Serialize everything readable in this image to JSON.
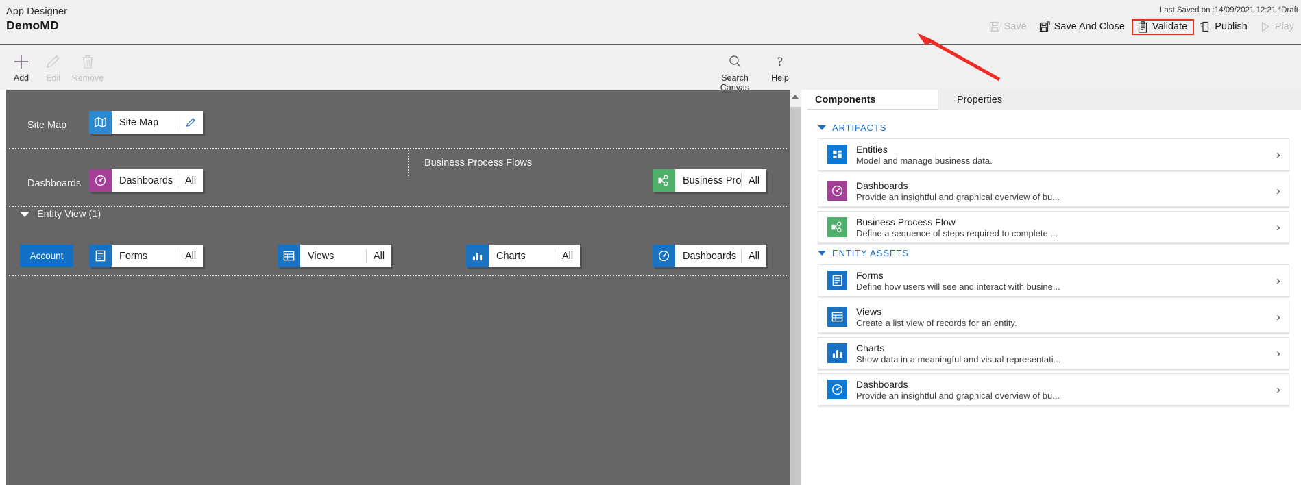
{
  "header": {
    "kicker": "App Designer",
    "title": "DemoMD",
    "last_saved": "Last Saved on :14/09/2021 12:21 *Draft",
    "commands": [
      {
        "label": "Save",
        "icon": "save-icon",
        "state": "disabled",
        "highlighted": false
      },
      {
        "label": "Save And Close",
        "icon": "save-close-icon",
        "state": "enabled",
        "highlighted": false
      },
      {
        "label": "Validate",
        "icon": "validate-icon",
        "state": "enabled",
        "highlighted": true
      },
      {
        "label": "Publish",
        "icon": "publish-icon",
        "state": "enabled",
        "highlighted": false
      },
      {
        "label": "Play",
        "icon": "play-icon",
        "state": "disabled",
        "highlighted": false
      }
    ],
    "highlight_color": "#ee2b24"
  },
  "ribbon": {
    "items": [
      {
        "label": "Add",
        "icon": "plus-icon",
        "state": "enabled"
      },
      {
        "label": "Edit",
        "icon": "pencil-icon",
        "state": "disabled"
      },
      {
        "label": "Remove",
        "icon": "trash-icon",
        "state": "disabled"
      }
    ],
    "right_items": [
      {
        "label": "Search Canvas",
        "icon": "search-icon",
        "state": "enabled"
      },
      {
        "label": "Help",
        "icon": "help-icon",
        "state": "enabled"
      }
    ]
  },
  "canvas": {
    "background": "#666666",
    "rows": [
      {
        "label": "Site Map",
        "tiles": [
          {
            "name": "Site Map",
            "icon": "sitemap-icon",
            "icon_color": "#2a8ad4",
            "trailing": "edit",
            "trailing_label": ""
          }
        ]
      },
      {
        "label": "Dashboards",
        "group_label": "Business Process Flows",
        "tiles": [
          {
            "name": "Dashboards",
            "icon": "dashboard-icon",
            "icon_color": "#a33f96",
            "trailing": "all",
            "trailing_label": "All"
          },
          {
            "name": "Business Proces...",
            "icon": "bpf-icon",
            "icon_color": "#4eb06b",
            "trailing": "all",
            "trailing_label": "All"
          }
        ]
      }
    ],
    "entity_view": {
      "label": "Entity View (1)",
      "entity_button": "Account",
      "tiles": [
        {
          "name": "Forms",
          "icon": "forms-icon",
          "icon_color": "#1a72c2",
          "trailing_label": "All"
        },
        {
          "name": "Views",
          "icon": "views-icon",
          "icon_color": "#1a72c2",
          "trailing_label": "All"
        },
        {
          "name": "Charts",
          "icon": "charts-icon",
          "icon_color": "#1a72c2",
          "trailing_label": "All"
        },
        {
          "name": "Dashboards",
          "icon": "dashboard-icon",
          "icon_color": "#1a72c2",
          "trailing_label": "All"
        }
      ]
    }
  },
  "right_panel": {
    "tabs": [
      {
        "label": "Components",
        "active": true
      },
      {
        "label": "Properties",
        "active": false
      }
    ],
    "sections": [
      {
        "title": "ARTIFACTS",
        "cards": [
          {
            "title": "Entities",
            "subtitle": "Model and manage business data.",
            "icon": "entities-icon",
            "icon_color": "#0b7ad6"
          },
          {
            "title": "Dashboards",
            "subtitle": "Provide an insightful and graphical overview of bu...",
            "icon": "dashboard-icon",
            "icon_color": "#a33f96"
          },
          {
            "title": "Business Process Flow",
            "subtitle": "Define a sequence of steps required to complete ...",
            "icon": "bpf-icon",
            "icon_color": "#4eb06b"
          }
        ]
      },
      {
        "title": "ENTITY ASSETS",
        "cards": [
          {
            "title": "Forms",
            "subtitle": "Define how users will see and interact with busine...",
            "icon": "forms-icon",
            "icon_color": "#1a72c2"
          },
          {
            "title": "Views",
            "subtitle": "Create a list view of records for an entity.",
            "icon": "views-icon",
            "icon_color": "#1a72c2"
          },
          {
            "title": "Charts",
            "subtitle": "Show data in a meaningful and visual representati...",
            "icon": "charts-icon",
            "icon_color": "#1a72c2"
          },
          {
            "title": "Dashboards",
            "subtitle": "Provide an insightful and graphical overview of bu...",
            "icon": "dashboard-icon",
            "icon_color": "#0b7ad6"
          }
        ]
      }
    ],
    "chevron_glyph": "›"
  }
}
